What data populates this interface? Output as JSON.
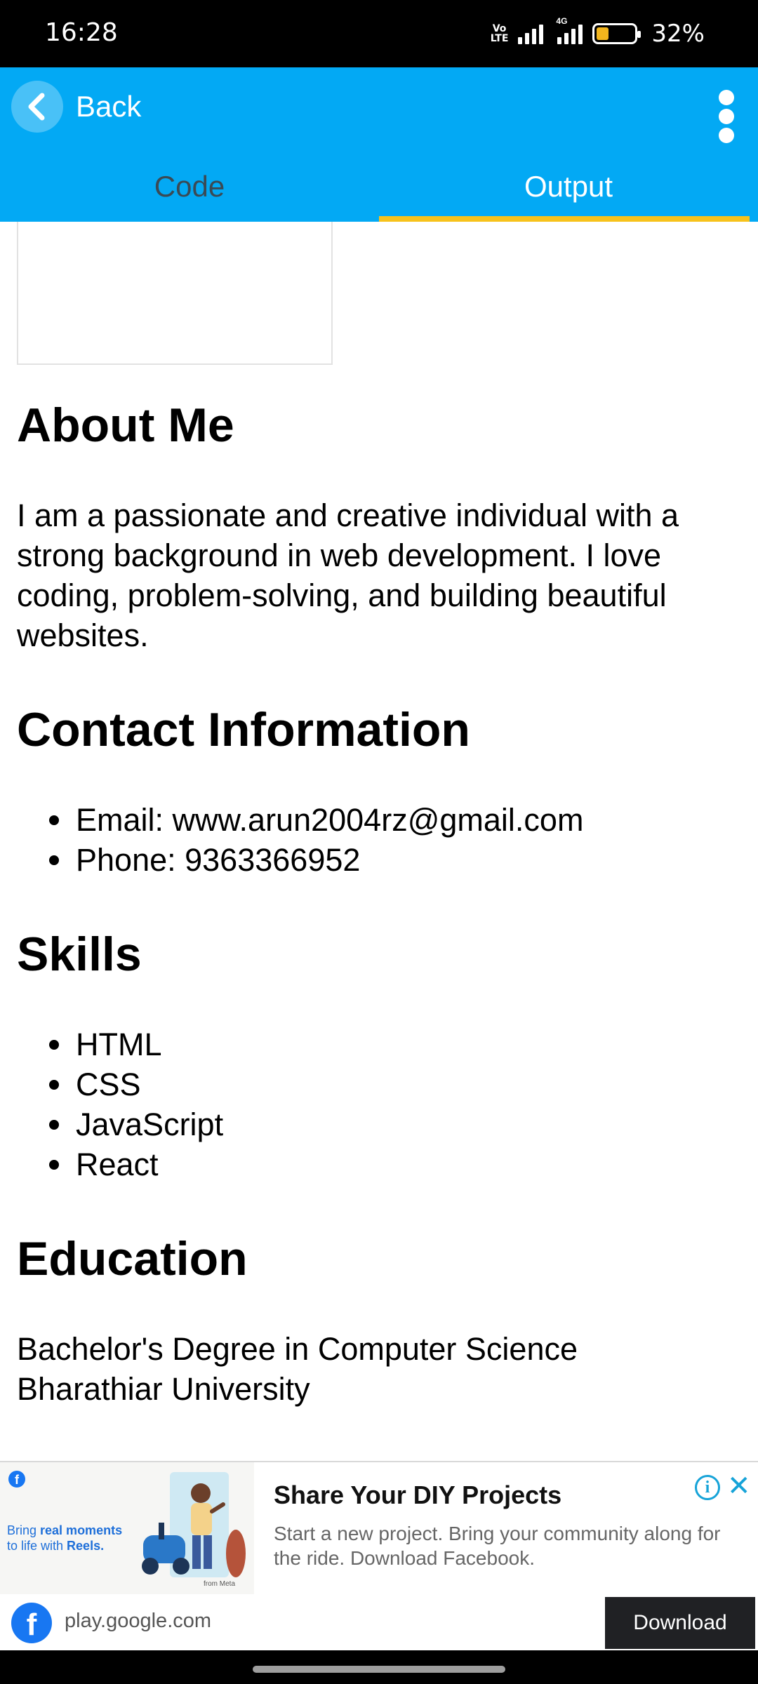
{
  "status_bar": {
    "time": "16:28",
    "volte_line1": "Vo",
    "volte_line2": "LTE",
    "network": "4G",
    "battery_level": 0.32,
    "battery_percent": "32%"
  },
  "app_bar": {
    "back_label": "Back",
    "tabs": [
      {
        "label": "Code",
        "active": false
      },
      {
        "label": "Output",
        "active": true
      }
    ],
    "accent_color": "#03a9f4",
    "indicator_color": "#f7c21b"
  },
  "content": {
    "about_title": "About Me",
    "about_text": "I am a passionate and creative individual with a strong background in web development. I love coding, problem-solving, and building beautiful websites.",
    "contact_title": "Contact Information",
    "contact_items": [
      "Email: www.arun2004rz@gmail.com",
      "Phone: 9363366952"
    ],
    "skills_title": "Skills",
    "skills": [
      "HTML",
      "CSS",
      "JavaScript",
      "React"
    ],
    "education_title": "Education",
    "education_degree": "Bachelor's Degree in Computer Science",
    "education_school": "Bharathiar University"
  },
  "ad": {
    "image_caption_part1": "Bring ",
    "image_caption_bold": "real moments",
    "image_caption_part2": "to life with ",
    "image_caption_bold2": "Reels.",
    "image_meta": "from Meta",
    "title": "Share Your DIY Projects",
    "description": "Start a new project. Bring your community along for the ride. Download Facebook.",
    "domain": "play.google.com",
    "cta": "Download"
  }
}
